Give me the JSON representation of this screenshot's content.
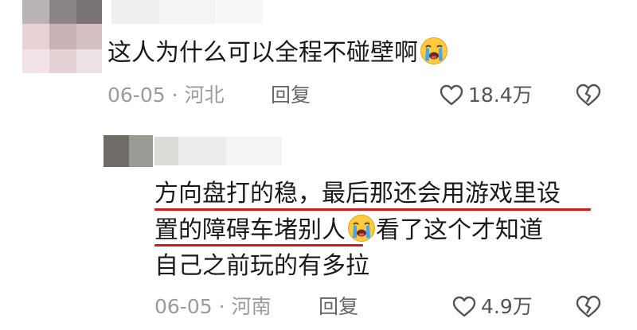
{
  "comments": [
    {
      "text": "这人为什么可以全程不碰壁啊",
      "emoji": "crying-face",
      "date": "06-05",
      "dot": "·",
      "location": "河北",
      "reply_label": "回复",
      "likes": "18.4万"
    },
    {
      "lines": [
        "方向盘打的稳，最后那还会用游戏里设",
        "置的障碍车堵别人",
        "看了这个才知道",
        "自己之前玩的有多拉"
      ],
      "emoji": "crying-face",
      "date": "06-05",
      "dot": "·",
      "location": "河南",
      "reply_label": "回复",
      "likes": "4.9万"
    }
  ],
  "colors": {
    "highlight_underline": "#d11a1a",
    "meta_text": "#9b9b9b",
    "body_text": "#1a1a1a"
  },
  "icons": {
    "like": "heart-outline-icon",
    "dislike": "broken-heart-outline-icon",
    "emoji": "loudly-crying-face"
  }
}
